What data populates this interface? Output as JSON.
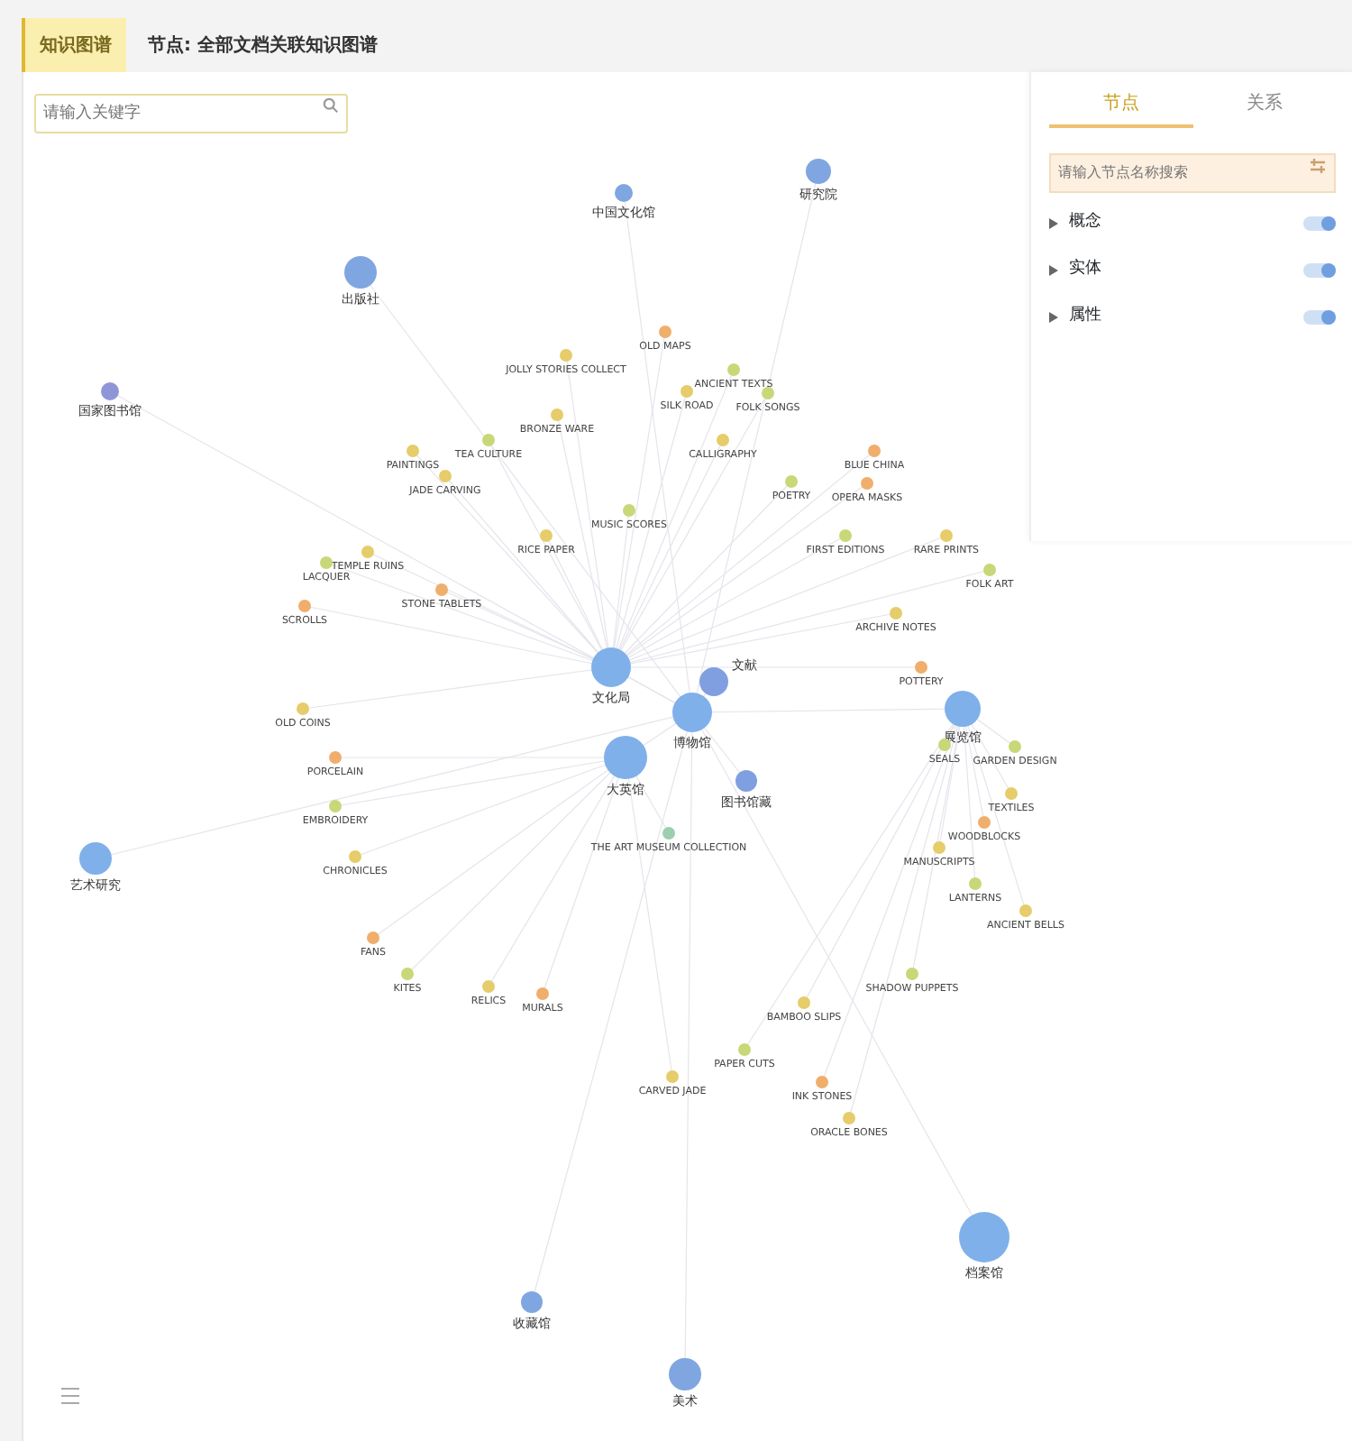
{
  "tabs": [
    {
      "label": "知识图谱",
      "selected": true
    },
    {
      "label": "节点: 全部文档关联知识图谱",
      "selected": false
    }
  ],
  "search": {
    "placeholder": "请输入关键字"
  },
  "panel": {
    "tabs": [
      {
        "label": "节点",
        "selected": true
      },
      {
        "label": "关系",
        "selected": false
      }
    ],
    "search": {
      "placeholder": "请输入节点名称搜索"
    },
    "rows": [
      {
        "label": "概念",
        "on": true
      },
      {
        "label": "实体",
        "on": true
      },
      {
        "label": "属性",
        "on": true
      }
    ]
  },
  "nodes": [
    {
      "kind": "hub",
      "label": "研究院",
      "color": "#7fa6e0"
    },
    {
      "kind": "hub",
      "label": "中国文化馆",
      "color": "#7fa6e0"
    },
    {
      "kind": "hub",
      "label": "出版社",
      "color": "#7fa6e0"
    },
    {
      "kind": "item",
      "label": "OLD MAPS",
      "color": "#f0ae6c"
    },
    {
      "kind": "item",
      "label": "JOLLY STORIES COLLECT",
      "color": "#e6cc6a"
    },
    {
      "kind": "item",
      "label": "ANCIENT TEXTS",
      "color": "#c8d878"
    },
    {
      "kind": "hub",
      "label": "国家图书馆",
      "color": "#8f96d8"
    },
    {
      "kind": "item",
      "label": "SILK ROAD",
      "color": "#e6cc6a"
    },
    {
      "kind": "item",
      "label": "FOLK SONGS",
      "color": "#c8d878"
    },
    {
      "kind": "item",
      "label": "BRONZE WARE",
      "color": "#e6cc6a"
    },
    {
      "kind": "item",
      "label": "TEA CULTURE",
      "color": "#c8d878"
    },
    {
      "kind": "item",
      "label": "CALLIGRAPHY",
      "color": "#e6cc6a"
    },
    {
      "kind": "item",
      "label": "PAINTINGS",
      "color": "#e6cc6a"
    },
    {
      "kind": "item",
      "label": "BLUE CHINA",
      "color": "#f0ae6c"
    },
    {
      "kind": "item",
      "label": "JADE CARVING",
      "color": "#e6cc6a"
    },
    {
      "kind": "item",
      "label": "POETRY",
      "color": "#c8d878"
    },
    {
      "kind": "item",
      "label": "OPERA MASKS",
      "color": "#f0ae6c"
    },
    {
      "kind": "item",
      "label": "MUSIC SCORES",
      "color": "#c8d878"
    },
    {
      "kind": "item",
      "label": "RICE PAPER",
      "color": "#e6cc6a"
    },
    {
      "kind": "item",
      "label": "FIRST EDITIONS",
      "color": "#c8d878"
    },
    {
      "kind": "item",
      "label": "RARE PRINTS",
      "color": "#e6cc6a"
    },
    {
      "kind": "item",
      "label": "TEMPLE RUINS",
      "color": "#e6cc6a"
    },
    {
      "kind": "item",
      "label": "LACQUER",
      "color": "#c8d878"
    },
    {
      "kind": "item",
      "label": "FOLK ART",
      "color": "#c8d878"
    },
    {
      "kind": "item",
      "label": "STONE TABLETS",
      "color": "#f0ae6c"
    },
    {
      "kind": "item",
      "label": "SCROLLS",
      "color": "#f0ae6c"
    },
    {
      "kind": "item",
      "label": "ARCHIVE NOTES",
      "color": "#e6cc6a"
    },
    {
      "kind": "hub",
      "label": "文化局",
      "color": "#7fb0ea"
    },
    {
      "kind": "item",
      "label": "POTTERY",
      "color": "#f0ae6c"
    },
    {
      "kind": "hub",
      "label": "文献",
      "color": "#7f9fe0"
    },
    {
      "kind": "item",
      "label": "OLD COINS",
      "color": "#e6cc6a"
    },
    {
      "kind": "hub",
      "label": "展览馆",
      "color": "#7fb0ea"
    },
    {
      "kind": "hub",
      "label": "博物馆",
      "color": "#7fb0ea"
    },
    {
      "kind": "item",
      "label": "SEALS",
      "color": "#c8d878"
    },
    {
      "kind": "item",
      "label": "GARDEN DESIGN",
      "color": "#c8d878"
    },
    {
      "kind": "item",
      "label": "PORCELAIN",
      "color": "#f0ae6c"
    },
    {
      "kind": "hub",
      "label": "大英馆",
      "color": "#7fb0ea"
    },
    {
      "kind": "hub",
      "label": "图书馆藏",
      "color": "#7f9fe0"
    },
    {
      "kind": "item",
      "label": "TEXTILES",
      "color": "#e6cc6a"
    },
    {
      "kind": "item",
      "label": "EMBROIDERY",
      "color": "#c8d878"
    },
    {
      "kind": "item",
      "label": "WOODBLOCKS",
      "color": "#f0ae6c"
    },
    {
      "kind": "item",
      "label": "THE ART MUSEUM COLLECTION",
      "color": "#9ccfb0"
    },
    {
      "kind": "item",
      "label": "MANUSCRIPTS",
      "color": "#e6cc6a"
    },
    {
      "kind": "item",
      "label": "CHRONICLES",
      "color": "#e6cc6a"
    },
    {
      "kind": "hub",
      "label": "艺术研究",
      "color": "#7fb0ea"
    },
    {
      "kind": "item",
      "label": "LANTERNS",
      "color": "#c8d878"
    },
    {
      "kind": "item",
      "label": "ANCIENT BELLS",
      "color": "#e6cc6a"
    },
    {
      "kind": "item",
      "label": "FANS",
      "color": "#f0ae6c"
    },
    {
      "kind": "item",
      "label": "KITES",
      "color": "#c8d878"
    },
    {
      "kind": "item",
      "label": "SHADOW PUPPETS",
      "color": "#c8d878"
    },
    {
      "kind": "item",
      "label": "RELICS",
      "color": "#e6cc6a"
    },
    {
      "kind": "item",
      "label": "MURALS",
      "color": "#f0ae6c"
    },
    {
      "kind": "item",
      "label": "BAMBOO SLIPS",
      "color": "#e6cc6a"
    },
    {
      "kind": "item",
      "label": "PAPER CUTS",
      "color": "#c8d878"
    },
    {
      "kind": "item",
      "label": "CARVED JADE",
      "color": "#e6cc6a"
    },
    {
      "kind": "item",
      "label": "INK STONES",
      "color": "#f0ae6c"
    },
    {
      "kind": "item",
      "label": "ORACLE BONES",
      "color": "#e6cc6a"
    },
    {
      "kind": "hub",
      "label": "档案馆",
      "color": "#7fb0ea"
    },
    {
      "kind": "hub",
      "label": "收藏馆",
      "color": "#7fa6e0"
    },
    {
      "kind": "hub",
      "label": "美术",
      "color": "#7fa6e0"
    }
  ]
}
